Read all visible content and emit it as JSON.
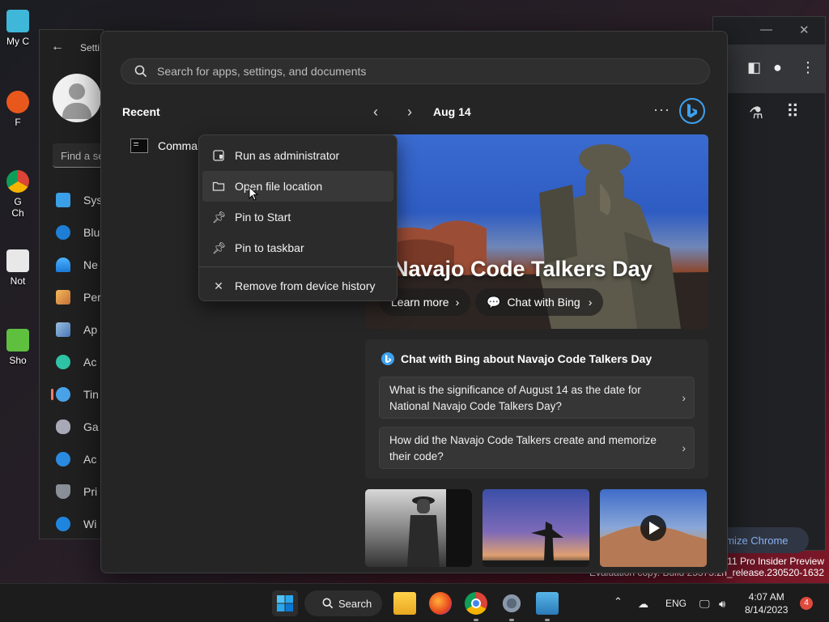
{
  "desktop": {
    "icons": [
      {
        "label": "My C"
      },
      {
        "label": "F"
      },
      {
        "label": "G\nCh"
      },
      {
        "label": "Not"
      },
      {
        "label": "Sho"
      }
    ]
  },
  "settings_window": {
    "title": "Setti",
    "find_placeholder": "Find a se",
    "items": [
      {
        "label": "Sys"
      },
      {
        "label": "Blu"
      },
      {
        "label": "Ne"
      },
      {
        "label": "Per"
      },
      {
        "label": "Ap"
      },
      {
        "label": "Ac"
      },
      {
        "label": "Tin"
      },
      {
        "label": "Ga"
      },
      {
        "label": "Ac"
      },
      {
        "label": "Pri"
      },
      {
        "label": "Wi"
      }
    ]
  },
  "chrome_window": {
    "customize_label": "omize Chrome"
  },
  "watermark": {
    "line1": "s 11 Pro Insider Preview",
    "line2": "Evaluation copy. Build 25375.zn_release.230520-1632"
  },
  "start_menu": {
    "search_placeholder": "Search for apps, settings, and documents",
    "recent_heading": "Recent",
    "recent_item_label": "Commar",
    "date_label": "Aug 14",
    "more_label": "···",
    "hero": {
      "title": "Navajo Code Talkers Day",
      "learn_more": "Learn more",
      "chat_with_bing": "Chat with Bing"
    },
    "chat_card": {
      "heading": "Chat with Bing about Navajo Code Talkers Day",
      "questions": [
        "What is the significance of August 14 as the date for National Navajo Code Talkers Day?",
        "How did the Navajo Code Talkers create and memorize their code?"
      ]
    }
  },
  "context_menu": {
    "items": [
      {
        "label": "Run as administrator"
      },
      {
        "label": "Open file location"
      },
      {
        "label": "Pin to Start"
      },
      {
        "label": "Pin to taskbar"
      },
      {
        "label": "Remove from device history"
      }
    ]
  },
  "taskbar": {
    "search_label": "Search",
    "language": "ENG",
    "time": "4:07 AM",
    "date": "8/14/2023",
    "notification_count": "4"
  },
  "colors": {
    "accent_blue": "#3da1f0",
    "windows_blue": "#0a78d4",
    "active_marker": "#f07c6c"
  }
}
